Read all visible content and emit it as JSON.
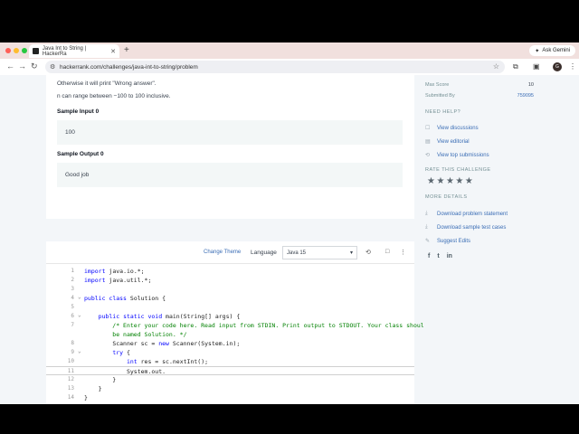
{
  "browser": {
    "tab_title": "Java Int to String | HackerRa",
    "tab_close": "✕",
    "new_tab": "+",
    "url": "hackerrank.com/challenges/java-int-to-string/problem",
    "ask_gemini": "Ask Gemini",
    "avatar_letter": "G"
  },
  "problem": {
    "otherwise_text": "Otherwise it will print \"Wrong answer\".",
    "range_text": "n can range between −100 to 100 inclusive.",
    "sample_input_heading": "Sample Input 0",
    "sample_input": "100",
    "sample_output_heading": "Sample Output 0",
    "sample_output": "Good job"
  },
  "sidebar": {
    "max_score_label": "Max Score",
    "max_score_value": "10",
    "submitted_by_label": "Submitted By",
    "submitted_by_value": "759095",
    "need_help": "NEED HELP?",
    "links_help": [
      "View discussions",
      "View editorial",
      "View top submissions"
    ],
    "rate_heading": "RATE THIS CHALLENGE",
    "rating": 0,
    "more_details": "MORE DETAILS",
    "links_details": [
      "Download problem statement",
      "Download sample test cases",
      "Suggest Edits"
    ]
  },
  "editor": {
    "change_theme": "Change Theme",
    "language_label": "Language",
    "language_value": "Java 15",
    "lines": [
      {
        "n": "1",
        "text": "import java.io.*;"
      },
      {
        "n": "2",
        "text": "import java.util.*;"
      },
      {
        "n": "3",
        "text": ""
      },
      {
        "n": "4",
        "text": "public class Solution {"
      },
      {
        "n": "5",
        "text": ""
      },
      {
        "n": "6",
        "text": "    public static void main(String[] args) {"
      },
      {
        "n": "7",
        "text": "        /* Enter your code here. Read input from STDIN. Print output to STDOUT. Your class shoul"
      },
      {
        "n": "",
        "text": "        be named Solution. */"
      },
      {
        "n": "8",
        "text": "        Scanner sc = new Scanner(System.in);"
      },
      {
        "n": "9",
        "text": "        try {"
      },
      {
        "n": "10",
        "text": "            int res = sc.nextInt();"
      },
      {
        "n": "11",
        "text": "            System.out."
      },
      {
        "n": "12",
        "text": "        }"
      },
      {
        "n": "13",
        "text": "    }"
      },
      {
        "n": "14",
        "text": "}"
      }
    ]
  }
}
